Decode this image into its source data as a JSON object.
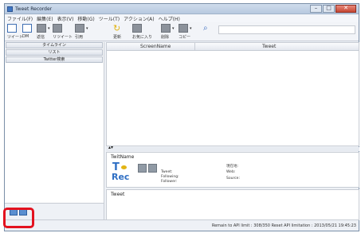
{
  "window": {
    "title": "Tweet Recorder"
  },
  "menu": [
    "ファイル(F)",
    "編集(E)",
    "表示(V)",
    "移動(G)",
    "ツール(T)",
    "アクション(A)",
    "ヘルプ(H)"
  ],
  "toolbar": {
    "buttons": [
      {
        "label": "ツイート",
        "icon": "compose-icon"
      },
      {
        "label": "DM",
        "icon": "message-icon"
      },
      {
        "label": "返信",
        "icon": "reply-icon"
      },
      {
        "label": "リツイート",
        "icon": "retweet-icon"
      },
      {
        "label": "引用",
        "icon": "quote-icon"
      },
      {
        "label": "更新",
        "icon": "refresh-icon"
      },
      {
        "label": "お気に入り",
        "icon": "favorite-icon"
      },
      {
        "label": "削除",
        "icon": "delete-icon"
      },
      {
        "label": "コピー",
        "icon": "copy-icon"
      }
    ],
    "search_icon": "search-icon",
    "search_value": ""
  },
  "sidebar": {
    "items": [
      "タイムライン",
      "リスト",
      "Twitter検索"
    ]
  },
  "grid": {
    "columns": [
      "ScreenName",
      "Tweet"
    ]
  },
  "user_panel": {
    "title": "TwitName",
    "logo_top": "T",
    "logo_bottom": "Rec",
    "left_labels": [
      "Tweet:",
      "Following:",
      "Follower:"
    ],
    "right_labels": [
      "現在地:",
      "Web:",
      "Source:"
    ]
  },
  "tweet_panel": {
    "title": "Tweet"
  },
  "status": "Remain to API limit : 308/350  Reset API limitation : 2013/05/21 19:45:23",
  "accent": {
    "highlight": "#e3121f",
    "brand_blue": "#2f6fc4"
  }
}
